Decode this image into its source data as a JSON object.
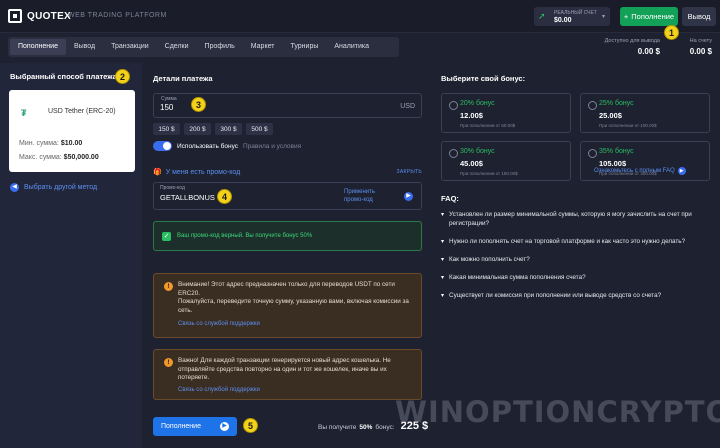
{
  "header": {
    "brand": "QUOTEX",
    "platform_label": "WEB TRADING PLATFORM",
    "account": {
      "label": "РЕАЛЬНЫЙ СЧЕТ",
      "value": "$0.00",
      "icon": "signal-arrow-icon",
      "caret": "▾"
    },
    "deposit_label": "Пополнение",
    "withdraw_label": "Вывод"
  },
  "tabs": [
    {
      "label": "Пополнение",
      "active": true
    },
    {
      "label": "Вывод"
    },
    {
      "label": "Транзакции"
    },
    {
      "label": "Сделки"
    },
    {
      "label": "Профиль"
    },
    {
      "label": "Маркет"
    },
    {
      "label": "Турниры"
    },
    {
      "label": "Аналитика"
    }
  ],
  "balances": {
    "available_label": "Доступно для вывода",
    "available_value": "0.00 $",
    "account_label": "На счету",
    "account_value": "0.00 $"
  },
  "payment_method": {
    "title": "Выбранный способ платежа",
    "name": "USD Tether (ERC-20)",
    "icon_glyph": "₮",
    "min_label": "Мин. сумма:",
    "min_value": "$10.00",
    "max_label": "Макс. сумма:",
    "max_value": "$50,000.00",
    "other_label": "Выбрать другой метод"
  },
  "details": {
    "title": "Детали платежа",
    "amount_label": "Сумма",
    "amount_value": "150",
    "currency": "USD",
    "quick_amounts": [
      "150 $",
      "200 $",
      "300 $",
      "500 $"
    ],
    "bonus_toggle_label": "Использовать бонус",
    "bonus_terms_label": "Правила и условия",
    "promo_title": "У меня есть промо-код",
    "promo_close": "ЗАКРЫТЬ",
    "promo_label": "Промо-код",
    "promo_value": "GETALLBONUS",
    "promo_apply": "Применить промо-код",
    "promo_success": "Ваш промо-код верный. Вы получите бонус 50%",
    "warning1_text": "Внимание! Этот адрес предназначен только для переводов USDT по сети ERC20.\nПожалуйста, переведите точную сумму, указанную вами, включая комиссии за сеть.",
    "warning1_link": "Связь со службой поддержки",
    "warning2_text": "Важно! Для каждой транзакции генерируется новый адрес кошелька. Не отправляйте средства повторно на один и тот же кошелек, иначе вы их потеряете.",
    "warning2_link": "Связь со службой поддержки",
    "pay_button": "Пополнение",
    "receive_prefix": "Вы получите",
    "receive_pct": "50%",
    "receive_suffix": "бонус:",
    "receive_amount": "225 $"
  },
  "bonuses": {
    "title": "Выберите свой бонус:",
    "items": [
      {
        "pct": "20% бонус",
        "amount": "12.00$",
        "note": "При пополнении от 60.00$"
      },
      {
        "pct": "25% бонус",
        "amount": "25.00$",
        "note": "При пополнении от 100.00$"
      },
      {
        "pct": "30% бонус",
        "amount": "45.00$",
        "note": "При пополнении от 150.00$"
      },
      {
        "pct": "35% бонус",
        "amount": "105.00$",
        "note": "При пополнении от 300.00$"
      }
    ]
  },
  "faq": {
    "link": "Ознакомьтесь с полным FAQ",
    "title": "FAQ:",
    "items": [
      "Установлен ли размер минимальной суммы, которую я могу зачислить на счет при регистрации?",
      "Нужно ли пополнять счет на торговой платформе и как часто это нужно делать?",
      "Как можно пополнить счет?",
      "Какая минимальная сумма пополнения счета?",
      "Существует ли комиссия при пополнении или выводе средств со счета?"
    ]
  },
  "markers": [
    "1",
    "2",
    "3",
    "4",
    "5"
  ],
  "watermark": "WINOPTIONCRYPTO.COM",
  "colors": {
    "accent_green": "#12a157",
    "accent_blue": "#1e73e8",
    "marker_yellow": "#f4d21a",
    "background": "#1e2130"
  }
}
